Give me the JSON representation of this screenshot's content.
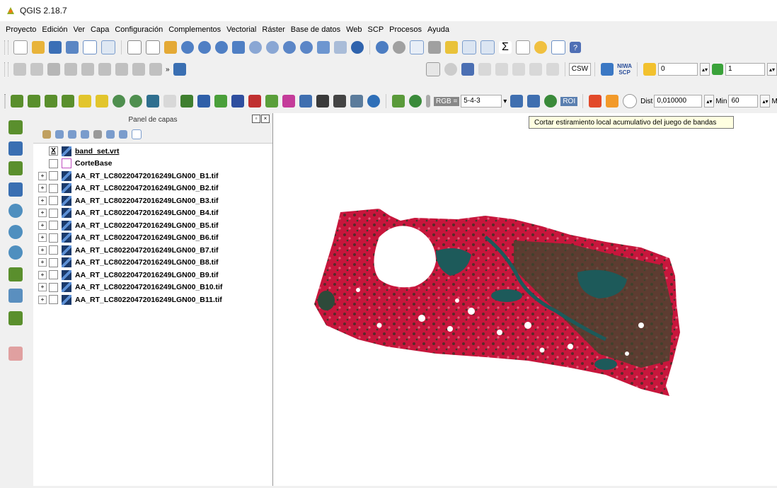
{
  "window": {
    "title": "QGIS 2.18.7"
  },
  "menu": [
    "Proyecto",
    "Edición",
    "Ver",
    "Capa",
    "Configuración",
    "Complementos",
    "Vectorial",
    "Ráster",
    "Base de datos",
    "Web",
    "SCP",
    "Procesos",
    "Ayuda"
  ],
  "toolbar3": {
    "zoom_value": "0",
    "band_value": "1",
    "sigma_symbol": "Σ",
    "help_symbol": "?"
  },
  "scp": {
    "rgb_label": "RGB =",
    "rgb_value": "5-4-3",
    "roi_label": "ROI",
    "dist_label": "Dist",
    "dist_value": "0,010000",
    "min_label": "Min",
    "min_value": "60",
    "max_label": "Má",
    "niwa_label": "NIWA",
    "scp_label": "SCP",
    "csw_label": "CSW"
  },
  "layers_panel": {
    "title": "Panel de capas",
    "layers": [
      {
        "name": "band_set.vrt",
        "checked": "X",
        "type": "raster",
        "tree": ""
      },
      {
        "name": "CorteBase",
        "checked": "",
        "type": "vector",
        "tree": ""
      },
      {
        "name": "AA_RT_LC80220472016249LGN00_B1.tif",
        "checked": "",
        "type": "raster",
        "tree": "+"
      },
      {
        "name": "AA_RT_LC80220472016249LGN00_B2.tif",
        "checked": "",
        "type": "raster",
        "tree": "+"
      },
      {
        "name": "AA_RT_LC80220472016249LGN00_B3.tif",
        "checked": "",
        "type": "raster",
        "tree": "+"
      },
      {
        "name": "AA_RT_LC80220472016249LGN00_B4.tif",
        "checked": "",
        "type": "raster",
        "tree": "+"
      },
      {
        "name": "AA_RT_LC80220472016249LGN00_B5.tif",
        "checked": "",
        "type": "raster",
        "tree": "+"
      },
      {
        "name": "AA_RT_LC80220472016249LGN00_B6.tif",
        "checked": "",
        "type": "raster",
        "tree": "+"
      },
      {
        "name": "AA_RT_LC80220472016249LGN00_B7.tif",
        "checked": "",
        "type": "raster",
        "tree": "+"
      },
      {
        "name": "AA_RT_LC80220472016249LGN00_B8.tif",
        "checked": "",
        "type": "raster",
        "tree": "+"
      },
      {
        "name": "AA_RT_LC80220472016249LGN00_B9.tif",
        "checked": "",
        "type": "raster",
        "tree": "+"
      },
      {
        "name": "AA_RT_LC80220472016249LGN00_B10.tif",
        "checked": "",
        "type": "raster",
        "tree": "+"
      },
      {
        "name": "AA_RT_LC80220472016249LGN00_B11.tif",
        "checked": "",
        "type": "raster",
        "tree": "+"
      }
    ]
  },
  "tooltip": {
    "text": "Cortar estiramiento local acumulativo del juego de bandas"
  },
  "colors": {
    "raster_red": "#c8163c",
    "water": "#1d5a5a",
    "vegetation": "#3a4a2e"
  }
}
